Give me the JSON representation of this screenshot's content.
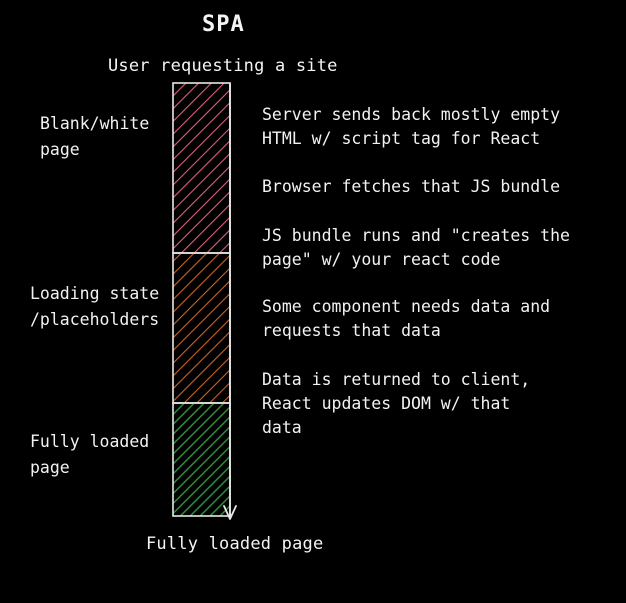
{
  "title": "SPA",
  "top_label": "User requesting a site",
  "bottom_label": "Fully loaded page",
  "left_labels": {
    "blank": "Blank/white\npage",
    "loading": "Loading state\n/placeholders",
    "loaded": "Fully loaded\npage"
  },
  "steps": [
    "Server sends back mostly empty\nHTML w/ script tag for React",
    "Browser fetches that JS bundle",
    "JS bundle runs and \"creates the\npage\" w/ your react code",
    "Some component needs data and\nrequests that data",
    "Data is returned to client,\nReact updates DOM w/ that\ndata"
  ],
  "colors": {
    "background": "#000000",
    "text": "#f4f4f4",
    "blank_phase": "#d9607a",
    "loading_phase": "#c8642a",
    "loaded_phase": "#2f8a3a",
    "outline": "#e8e8e8"
  }
}
